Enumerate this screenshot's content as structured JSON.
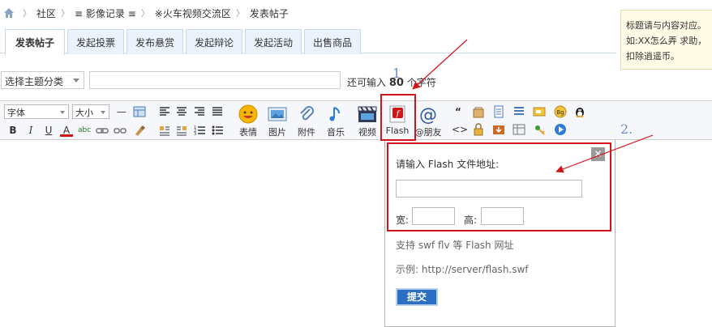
{
  "breadcrumb": {
    "items": [
      "社区",
      "≡ 影像记录 ≡",
      "※火车视频交流区",
      "发表帖子"
    ]
  },
  "tip": {
    "lines": [
      "标题请与内容对应。",
      "如:XX怎么弄 求助，",
      "扣除逍遥币。"
    ]
  },
  "tabs": [
    "发表帖子",
    "发起投票",
    "发布悬赏",
    "发起辩论",
    "发起活动",
    "出售商品"
  ],
  "subject": {
    "category_select": "选择主题分类",
    "title_value": "",
    "remain_prefix": "还可输入",
    "remain_count": "80",
    "remain_suffix": "个字符"
  },
  "toolbar": {
    "font_select": "字体",
    "size_select": "大小",
    "buttons": [
      "表情",
      "图片",
      "附件",
      "音乐",
      "视频",
      "Flash",
      "@朋友"
    ]
  },
  "flash_popup": {
    "prompt": "请输入 Flash 文件地址:",
    "url_value": "",
    "width_label": "宽:",
    "height_label": "高:",
    "support_text": "支持 swf flv 等 Flash 网址",
    "example_text": "示例: http://server/flash.swf",
    "submit_label": "提交",
    "close_glyph": "✕"
  },
  "annotations": {
    "label_1": "1",
    "label_2": "2."
  },
  "colors": {
    "annotation_red": "#d0161b",
    "tab_bg": "#eaf2fb",
    "submit_blue": "#2a6fc2"
  }
}
